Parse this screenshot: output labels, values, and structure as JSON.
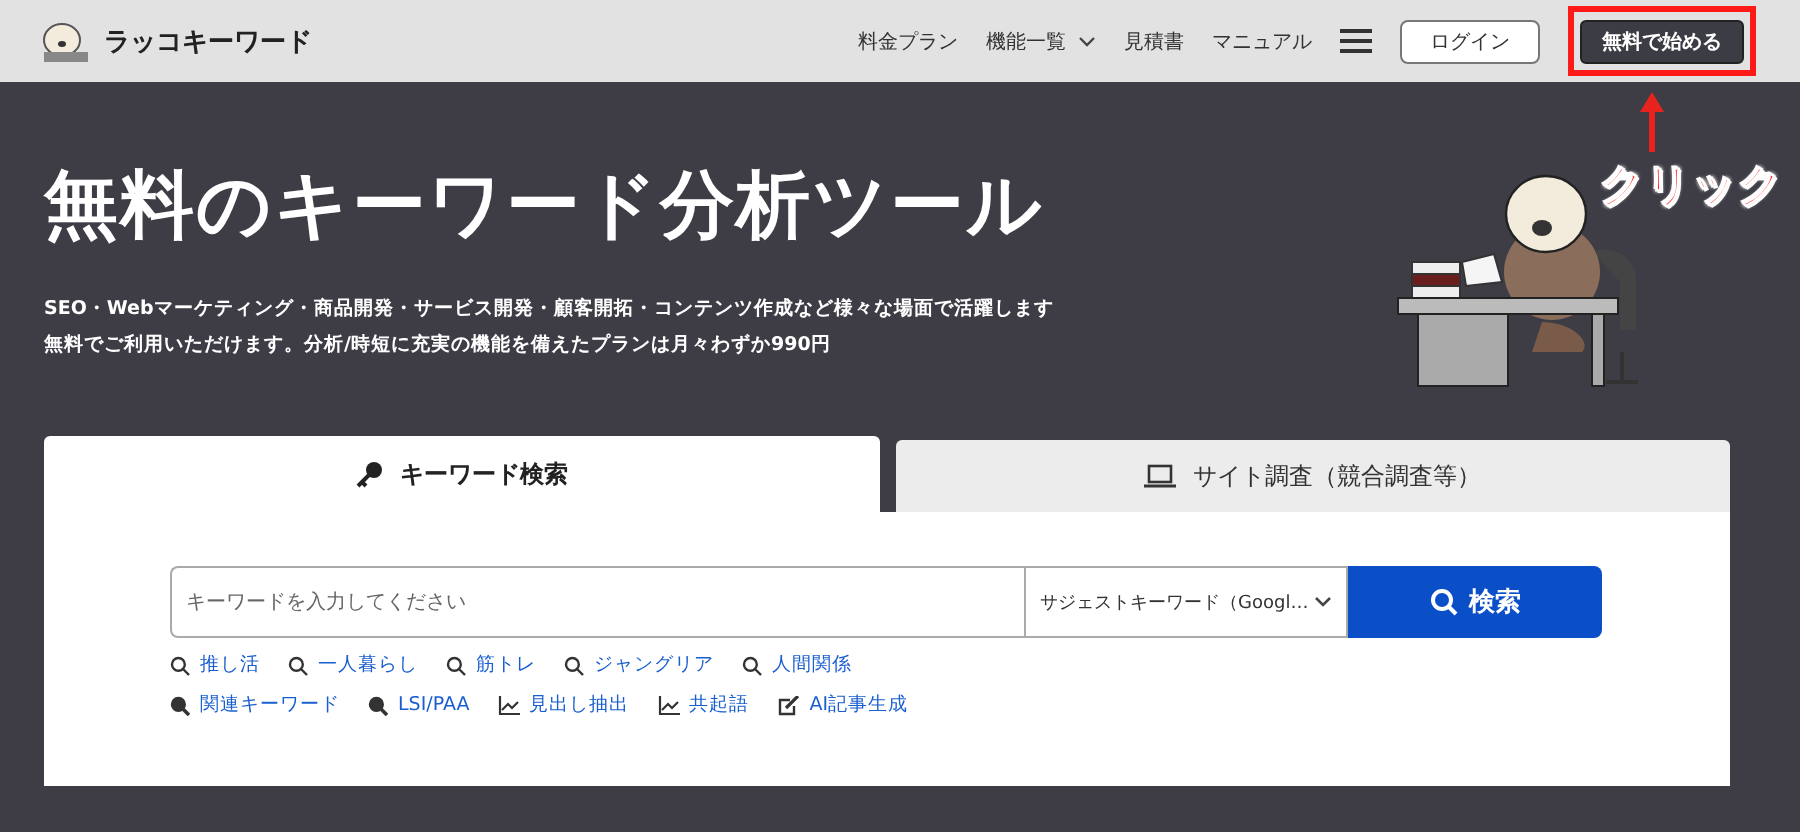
{
  "header": {
    "logo": "ラッコキーワード",
    "nav": [
      {
        "label": "料金プラン",
        "dropdown": false
      },
      {
        "label": "機能一覧",
        "dropdown": true
      },
      {
        "label": "見積書",
        "dropdown": false
      },
      {
        "label": "マニュアル",
        "dropdown": false
      }
    ],
    "login": "ログイン",
    "start": "無料で始める"
  },
  "annotation": {
    "text": "クリック"
  },
  "hero": {
    "title": "無料のキーワード分析ツール",
    "lines": [
      "SEO・Webマーケティング・商品開発・サービス開発・顧客開拓・コンテンツ作成など様々な場面で活躍します",
      "無料でご利用いただけます。分析/時短に充実の機能を備えたプランは月々わずか990円"
    ]
  },
  "tabs": [
    {
      "label": "キーワード検索",
      "selected": true
    },
    {
      "label": "サイト調査（競合調査等）",
      "selected": false
    }
  ],
  "search": {
    "placeholder": "キーワードを入力してください",
    "mode": "サジェストキーワード（Googl…",
    "button": "検索"
  },
  "link_rows": [
    [
      {
        "label": "推し活",
        "kind": "search"
      },
      {
        "label": "一人暮らし",
        "kind": "search"
      },
      {
        "label": "筋トレ",
        "kind": "search"
      },
      {
        "label": "ジャングリア",
        "kind": "search"
      },
      {
        "label": "人間関係",
        "kind": "search"
      }
    ],
    [
      {
        "label": "関連キーワード",
        "kind": "search-bold"
      },
      {
        "label": "LSI/PAA",
        "kind": "search-bold"
      },
      {
        "label": "見出し抽出",
        "kind": "chart"
      },
      {
        "label": "共起語",
        "kind": "chart"
      },
      {
        "label": "AI記事生成",
        "kind": "edit"
      }
    ]
  ]
}
